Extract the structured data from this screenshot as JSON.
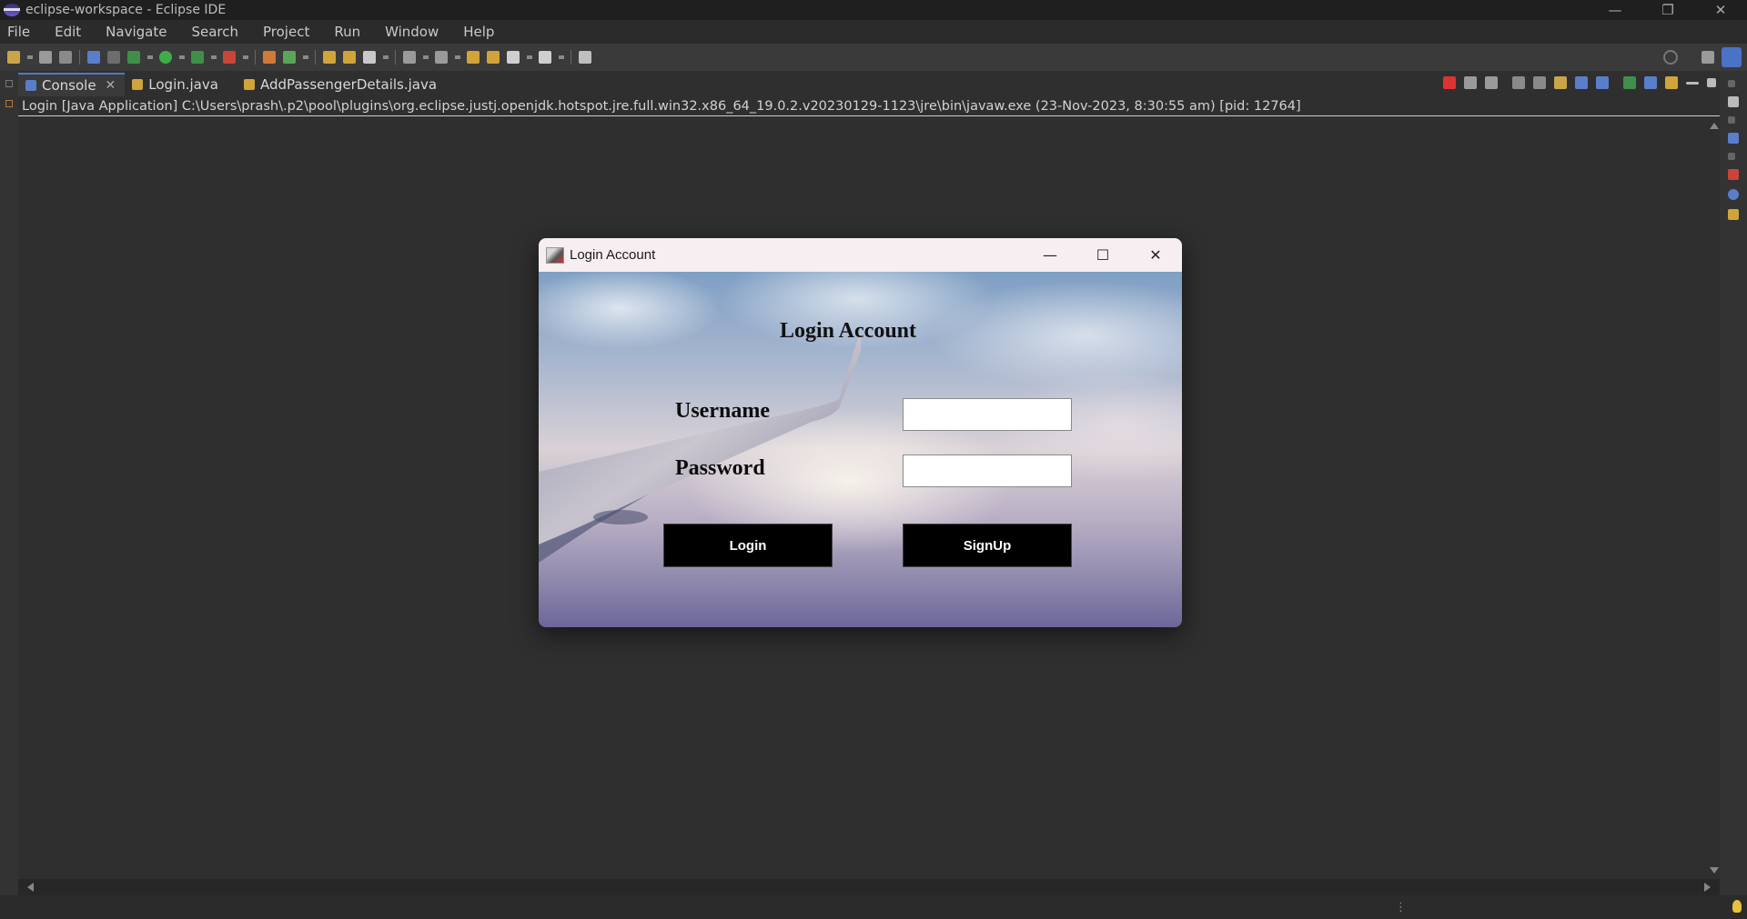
{
  "window": {
    "title": "eclipse-workspace - Eclipse IDE",
    "minimize": "—",
    "restore": "❐",
    "close": "✕"
  },
  "menu": [
    "File",
    "Edit",
    "Navigate",
    "Search",
    "Project",
    "Run",
    "Window",
    "Help"
  ],
  "tabs": [
    {
      "label": "Console",
      "icon": "console-icon",
      "active": true,
      "close": "✕"
    },
    {
      "label": "Login.java",
      "icon": "java-file-icon",
      "active": false
    },
    {
      "label": "AddPassengerDetails.java",
      "icon": "java-file-icon",
      "active": false
    }
  ],
  "console": {
    "header": "Login [Java Application] C:\\Users\\prash\\.p2\\pool\\plugins\\org.eclipse.justj.openjdk.hotspot.jre.full.win32.x86_64_19.0.2.v20230129-1123\\jre\\bin\\javaw.exe  (23-Nov-2023, 8:30:55 am) [pid: 12764]"
  },
  "dialog": {
    "title": "Login Account",
    "minimize": "—",
    "maximize": "☐",
    "close": "✕",
    "heading": "Login Account",
    "username_label": "Username",
    "password_label": "Password",
    "username_value": "",
    "password_value": "",
    "login_button": "Login",
    "signup_button": "SignUp"
  },
  "status": {
    "dots": "⋮"
  },
  "colors": {
    "accent": "#4a7ac7",
    "background": "#2f2f2f",
    "button_bg": "#000000",
    "dialog_titlebar": "#f7eef2"
  }
}
